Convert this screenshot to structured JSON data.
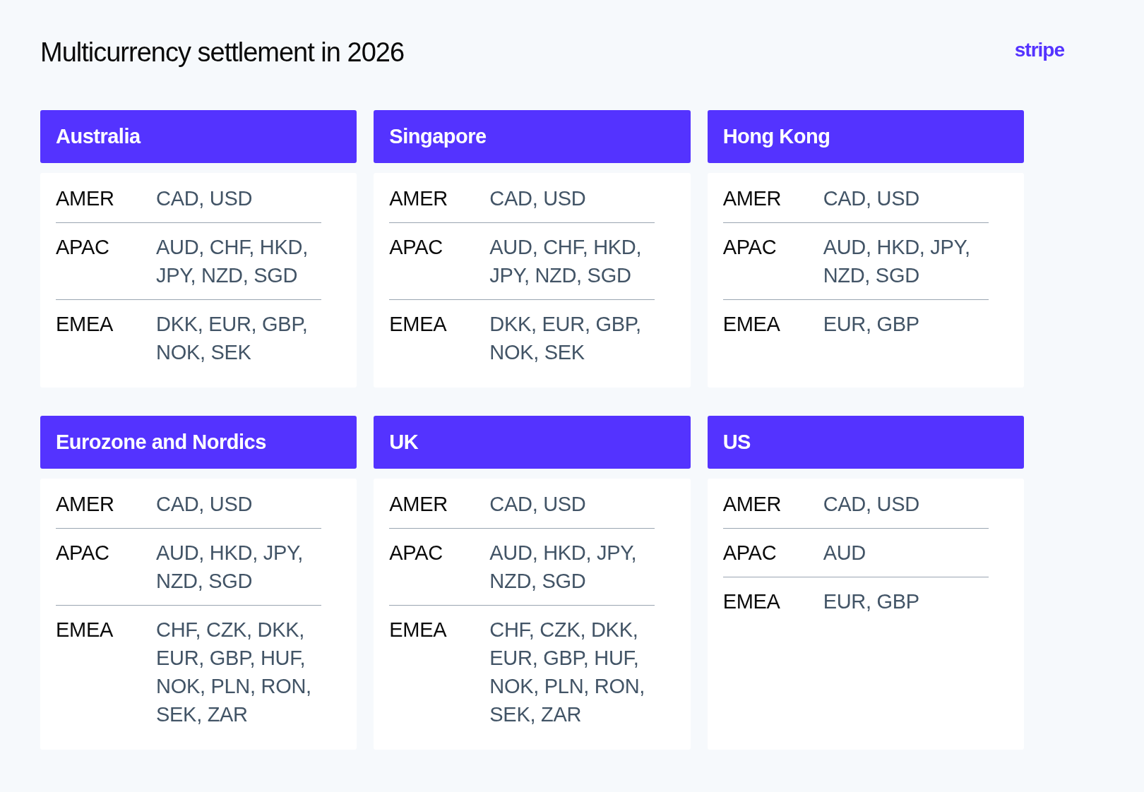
{
  "title": "Multicurrency settlement in 2026",
  "logo": "stripe",
  "regions": [
    {
      "name": "Australia",
      "rows": [
        {
          "label": "AMER",
          "currencies": "CAD, USD"
        },
        {
          "label": "APAC",
          "currencies": "AUD, CHF, HKD, JPY, NZD, SGD"
        },
        {
          "label": "EMEA",
          "currencies": "DKK, EUR, GBP, NOK, SEK"
        }
      ]
    },
    {
      "name": "Singapore",
      "rows": [
        {
          "label": "AMER",
          "currencies": "CAD, USD"
        },
        {
          "label": "APAC",
          "currencies": "AUD, CHF, HKD, JPY, NZD, SGD"
        },
        {
          "label": "EMEA",
          "currencies": "DKK, EUR, GBP, NOK, SEK"
        }
      ]
    },
    {
      "name": "Hong Kong",
      "rows": [
        {
          "label": "AMER",
          "currencies": "CAD, USD"
        },
        {
          "label": "APAC",
          "currencies": "AUD, HKD, JPY, NZD, SGD"
        },
        {
          "label": "EMEA",
          "currencies": "EUR, GBP"
        }
      ]
    },
    {
      "name": "Eurozone and Nordics",
      "rows": [
        {
          "label": "AMER",
          "currencies": "CAD, USD"
        },
        {
          "label": "APAC",
          "currencies": "AUD, HKD, JPY, NZD, SGD"
        },
        {
          "label": "EMEA",
          "currencies": "CHF, CZK, DKK, EUR, GBP, HUF, NOK, PLN, RON, SEK, ZAR"
        }
      ]
    },
    {
      "name": "UK",
      "rows": [
        {
          "label": "AMER",
          "currencies": "CAD, USD"
        },
        {
          "label": "APAC",
          "currencies": "AUD, HKD, JPY, NZD, SGD"
        },
        {
          "label": "EMEA",
          "currencies": "CHF, CZK, DKK, EUR, GBP, HUF, NOK, PLN, RON, SEK, ZAR"
        }
      ]
    },
    {
      "name": "US",
      "rows": [
        {
          "label": "AMER",
          "currencies": "CAD, USD"
        },
        {
          "label": "APAC",
          "currencies": "AUD"
        },
        {
          "label": "EMEA",
          "currencies": "EUR, GBP"
        }
      ]
    }
  ]
}
